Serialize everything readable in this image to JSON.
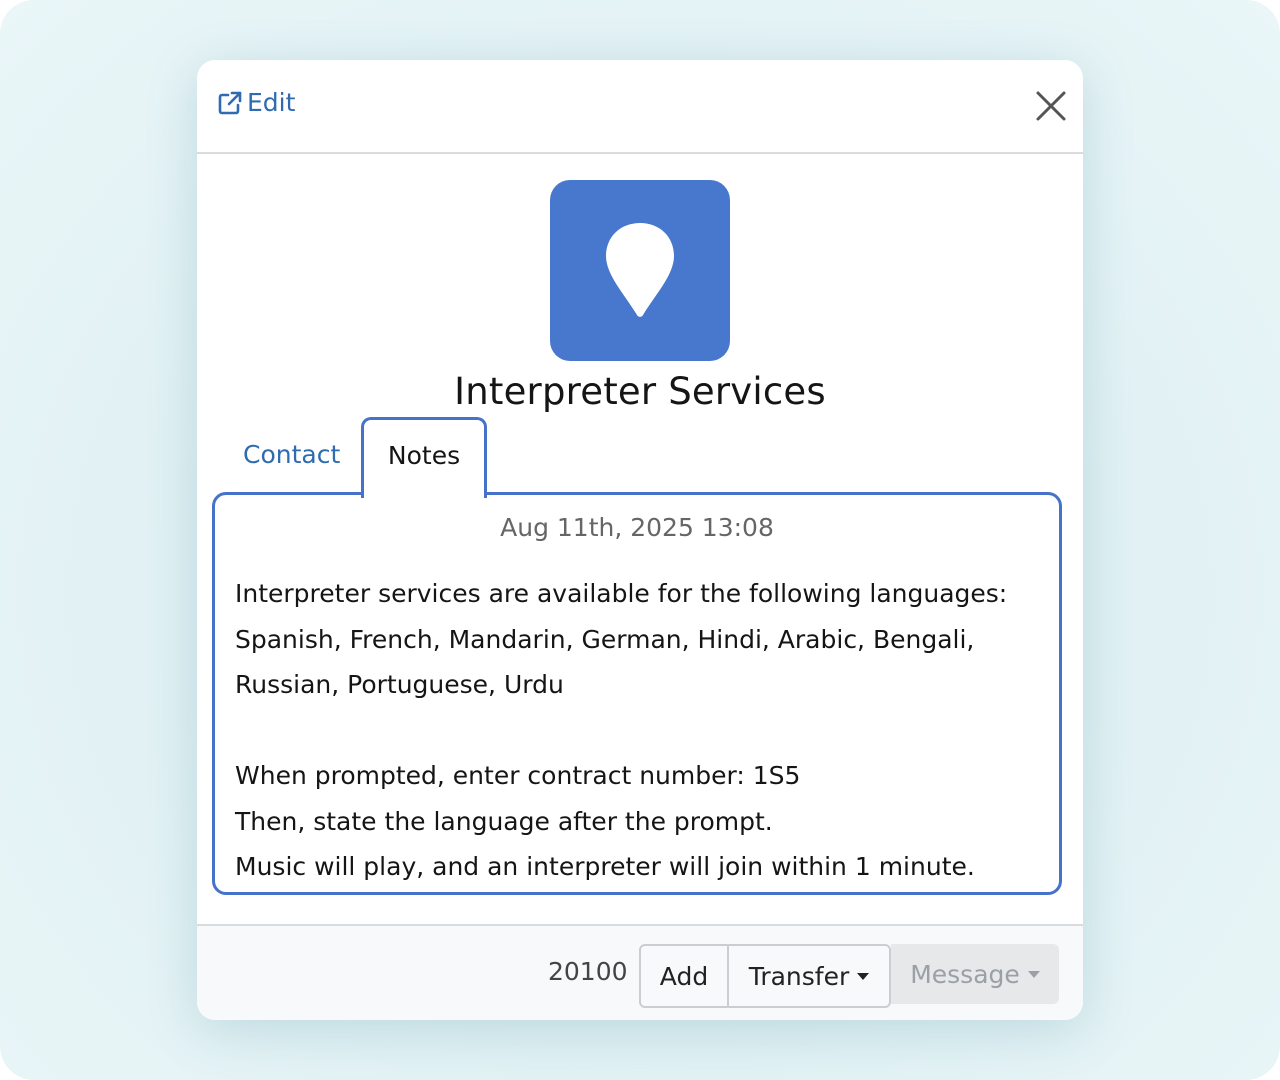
{
  "header": {
    "edit_label": "Edit",
    "edit_icon": "external-edit-icon",
    "close_icon": "close-icon"
  },
  "contact": {
    "name": "Interpreter Services",
    "avatar_icon": "location-pin-icon",
    "avatar_color": "#4878cd"
  },
  "tabs": [
    {
      "label": "Contact",
      "active": false
    },
    {
      "label": "Notes",
      "active": true
    }
  ],
  "notes": {
    "date": "Aug 11th, 2025 13:08",
    "lines": [
      "Interpreter services are available for the following languages:",
      "Spanish, French, Mandarin, German, Hindi, Arabic, Bengali,",
      "Russian, Portuguese, Urdu",
      "",
      "When prompted, enter contract number: 1S5",
      "Then, state the language after the prompt.",
      "Music will play, and an interpreter will join within 1 minute."
    ]
  },
  "footer": {
    "extension": "20100",
    "add_label": "Add",
    "transfer_label": "Transfer",
    "message_label": "Message",
    "message_disabled": true
  },
  "colors": {
    "accent": "#4673c9",
    "link": "#2f6bb0"
  }
}
